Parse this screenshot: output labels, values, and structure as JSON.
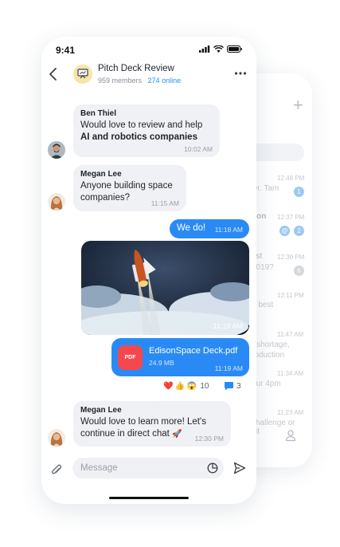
{
  "status_bar": {
    "time": "9:41"
  },
  "header": {
    "title": "Pitch Deck Review",
    "members": "959 members",
    "online": "274 online"
  },
  "messages": [
    {
      "sender": "Ben Thiel",
      "text": "Would love to review and help",
      "text_bold": "AI and robotics companies",
      "time": "10:02 AM"
    },
    {
      "sender": "Megan Lee",
      "text_line1": "Anyone building space",
      "text_line2": "companies?",
      "time": "11:15 AM"
    },
    {
      "text": "We do!",
      "time": "11:18 AM"
    },
    {
      "image_icon": "rocket-launch-photo",
      "time": "11:19 AM"
    },
    {
      "file_name": "EdisonSpace Deck.pdf",
      "file_size": "24.9 MB",
      "file_type": "PDF",
      "time": "11:19 AM"
    },
    {
      "sender": "Megan Lee",
      "text_line1": "Would love to learn more! Let's",
      "text_line2": "continue in direct chat",
      "emoji": "🚀",
      "time": "12:30 PM"
    }
  ],
  "reactions": {
    "heart": "❤️",
    "thumbs_up": "👍",
    "scream": "😱",
    "count": "10",
    "replies": "3"
  },
  "composer": {
    "placeholder": "Message"
  },
  "back_screen": {
    "rows": [
      {
        "title": "k",
        "subtitle": "Dr. Tam",
        "time": "12:48 PM",
        "badge": "1"
      },
      {
        "title": "tion",
        "subtitle": "",
        "time": "12:37 PM",
        "badge": "2"
      },
      {
        "title": "est",
        "subtitle": "2019?",
        "time": "12:30 PM",
        "badge": "6"
      },
      {
        "title": "",
        "subtitle": "e best",
        "time": "12:11 PM",
        "badge": ""
      },
      {
        "title": "",
        "subtitle": "r shortage,",
        "subtitle2": "roduction",
        "time": "11:47 AM",
        "badge": ""
      },
      {
        "title": "",
        "subtitle": "our 4pm",
        "time": "11:34 AM",
        "badge": ""
      },
      {
        "title": "",
        "subtitle": "challenge or",
        "subtitle2": "xit",
        "time": "11:23 AM",
        "badge": ""
      }
    ]
  },
  "colors": {
    "accent": "#2a8af5",
    "online": "#2d8ff0",
    "pdf": "#f5474e",
    "bubble_in": "#f0f1f4"
  }
}
